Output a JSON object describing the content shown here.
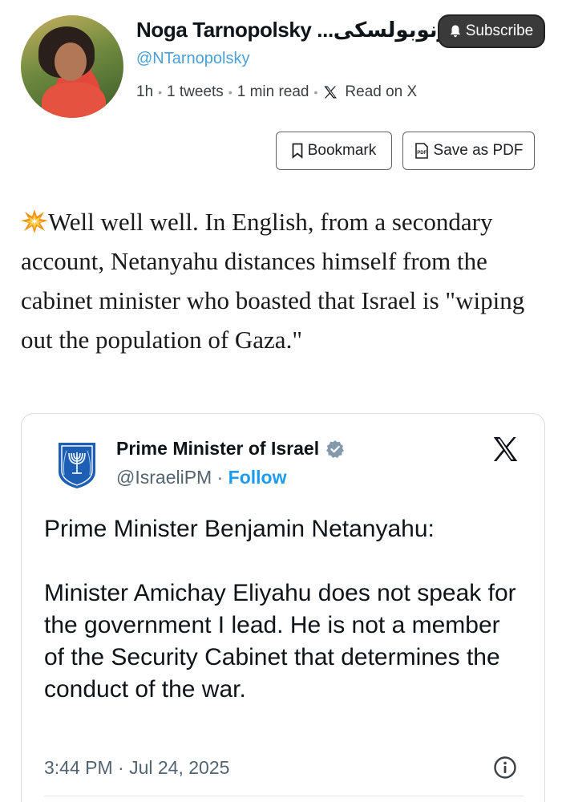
{
  "author": {
    "name": "Noga Tarnopolsky ...ترنوبولسكى",
    "handle": "@NTarnopolsky",
    "avatar_icon": "profile-photo"
  },
  "subscribe_label": "Subscribe",
  "meta": {
    "age": "1h",
    "tweets": "1 tweets",
    "read_time": "1 min read",
    "read_on": "Read on X"
  },
  "actions": {
    "bookmark_label": "Bookmark",
    "pdf_label": "Save as PDF"
  },
  "tweet": {
    "emoji": "collision-emoji",
    "text": "Well well well. In English, from a secondary account, Netanyahu distances himself from the cabinet minister who boasted that Israel is \"wiping out the population of Gaza.\""
  },
  "embed": {
    "name": "Prime Minister of Israel",
    "handle": "@IsraeliPM",
    "separator": "·",
    "follow_label": "Follow",
    "paragraphs": [
      "Prime Minister Benjamin Netanyahu:",
      "Minister Amichay Eliyahu does not speak for the government I lead. He is not a member of the Security Cabinet that determines the conduct of the war."
    ],
    "timestamp": "3:44 PM · Jul 24, 2025"
  },
  "colors": {
    "link": "#1d9bf0",
    "handle": "#4a9fd8",
    "subscribe_bg": "#3a3a3a",
    "verified": "#829aab"
  }
}
